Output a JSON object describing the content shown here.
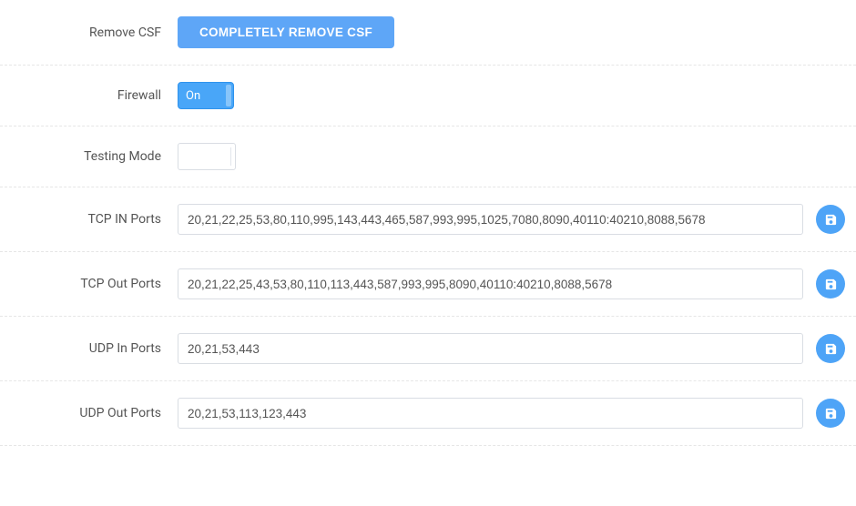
{
  "rows": {
    "remove_csf": {
      "label": "Remove CSF",
      "button": "COMPLETELY REMOVE CSF"
    },
    "firewall": {
      "label": "Firewall",
      "state_label": "On"
    },
    "testing_mode": {
      "label": "Testing Mode",
      "value": ""
    },
    "tcp_in": {
      "label": "TCP IN Ports",
      "value": "20,21,22,25,53,80,110,995,143,443,465,587,993,995,1025,7080,8090,40110:40210,8088,5678"
    },
    "tcp_out": {
      "label": "TCP Out Ports",
      "value": "20,21,22,25,43,53,80,110,113,443,587,993,995,8090,40110:40210,8088,5678"
    },
    "udp_in": {
      "label": "UDP In Ports",
      "value": "20,21,53,443"
    },
    "udp_out": {
      "label": "UDP Out Ports",
      "value": "20,21,53,113,123,443"
    }
  },
  "colors": {
    "accent": "#4ea4f7"
  }
}
